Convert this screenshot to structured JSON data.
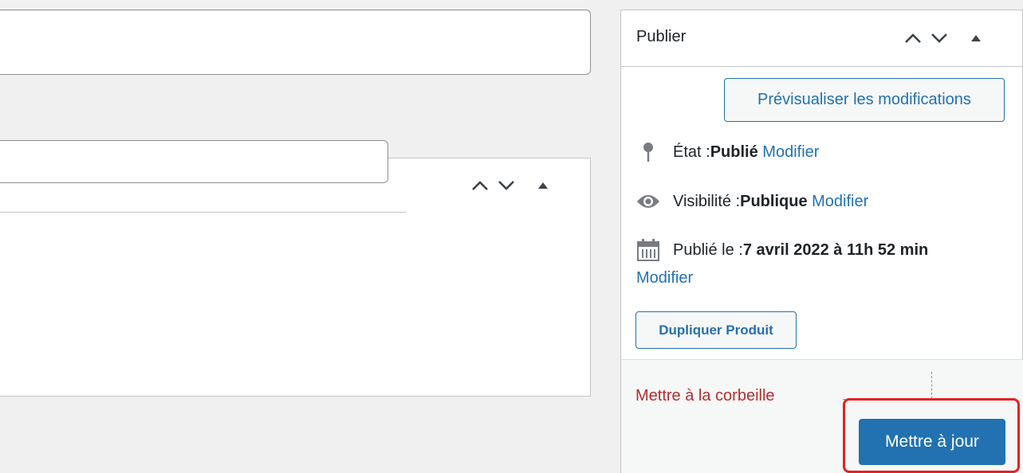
{
  "publish": {
    "title": "Publier",
    "preview_label": "Prévisualiser les modifications",
    "status": {
      "label": "État : ",
      "value": "Publié",
      "edit": "Modifier"
    },
    "visibility": {
      "label": "Visibilité : ",
      "value": "Publique",
      "edit": "Modifier"
    },
    "published": {
      "label": "Publié le : ",
      "value": "7 avril 2022 à 11h 52 min",
      "edit": "Modifier"
    },
    "duplicate_label": "Dupliquer Produit",
    "trash_label": "Mettre à la corbeille",
    "update_label": "Mettre à jour"
  },
  "icons": {
    "move_up": "chevron-up-icon",
    "move_down": "chevron-down-icon",
    "toggle": "triangle-up-icon",
    "status": "pin-icon",
    "visibility": "eye-icon",
    "date": "calendar-icon"
  },
  "colors": {
    "accent": "#2271b1",
    "danger": "#b32d2e",
    "highlight": "#e32222"
  }
}
